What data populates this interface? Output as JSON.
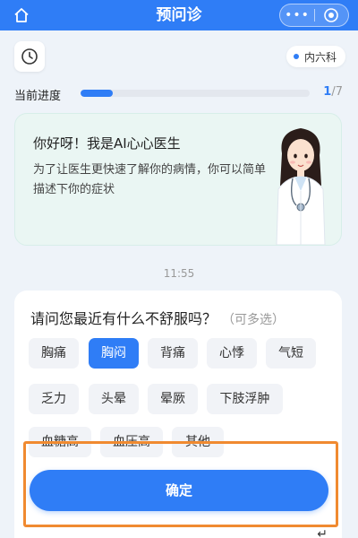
{
  "header": {
    "title": "预问诊",
    "more_label": "•••",
    "home_icon": "home-icon",
    "close_icon": "record-close-icon"
  },
  "toolbar": {
    "clock_icon": "clock-icon",
    "department": "内六科"
  },
  "progress": {
    "label": "当前进度",
    "current": "1",
    "total": "/7",
    "fraction": 0.14
  },
  "greeting": {
    "title": "你好呀！我是AI心心医生",
    "text": "为了让医生更快速了解你的病情，你可以简单描述下你的症状"
  },
  "chat": {
    "time": "11:55"
  },
  "question": {
    "title": "请问您最近有什么不舒服吗？",
    "multi_hint": "（可多选）",
    "options": [
      {
        "label": "胸痛",
        "selected": false
      },
      {
        "label": "胸闷",
        "selected": true
      },
      {
        "label": "背痛",
        "selected": false
      },
      {
        "label": "心悸",
        "selected": false
      },
      {
        "label": "气短",
        "selected": false
      },
      {
        "label": "乏力",
        "selected": false
      },
      {
        "label": "头晕",
        "selected": false
      },
      {
        "label": "晕厥",
        "selected": false
      },
      {
        "label": "下肢浮肿",
        "selected": false
      },
      {
        "label": "血糖高",
        "selected": false
      },
      {
        "label": "血压高",
        "selected": false
      },
      {
        "label": "其他",
        "selected": false
      }
    ]
  },
  "actions": {
    "confirm_label": "确定",
    "back_glyph": "↵"
  },
  "colors": {
    "primary": "#2f7df6",
    "highlight": "#f08a30",
    "card_green": "#eaf6f3"
  }
}
